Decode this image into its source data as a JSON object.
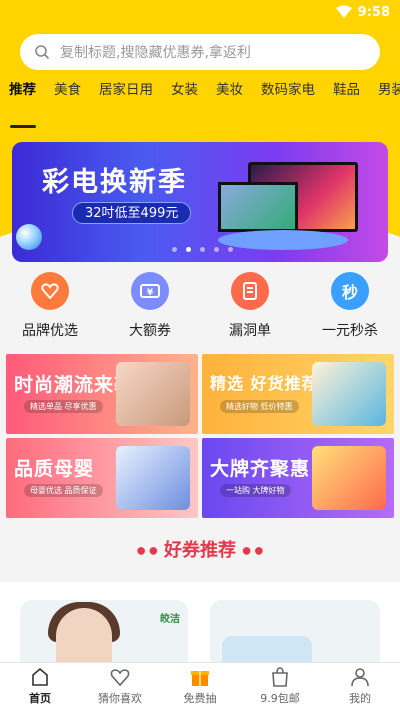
{
  "status_bar": {
    "time": "9:58"
  },
  "search": {
    "placeholder": "复制标题,搜隐藏优惠券,拿返利"
  },
  "category_tabs": [
    "推荐",
    "美食",
    "居家日用",
    "女装",
    "美妆",
    "数码家电",
    "鞋品",
    "男装"
  ],
  "banner": {
    "headline": "彩电换新季",
    "subline": "32吋低至499元"
  },
  "quick_links": [
    {
      "label": "品牌优选",
      "icon": "heart-badge-icon",
      "color": "#ff7a3d"
    },
    {
      "label": "大额券",
      "icon": "coupon-icon",
      "color": "#7b8cff"
    },
    {
      "label": "漏洞单",
      "icon": "bookmark-icon",
      "color": "#ff6a4d"
    },
    {
      "label": "一元秒杀",
      "icon": "flash-sale-icon",
      "color": "#3aa0ff",
      "glyph": "秒"
    }
  ],
  "promos": [
    {
      "title": "时尚潮流来袭",
      "caption": "精选单品 尽享优惠"
    },
    {
      "title": "精选 好货推荐",
      "caption": "精选好物 低价特惠"
    },
    {
      "title": "品质母婴",
      "caption": "母婴优选 品质保证"
    },
    {
      "title": "大牌齐聚惠",
      "caption": "一站购 大牌好物"
    }
  ],
  "section": {
    "title": "好券推荐"
  },
  "cards": {
    "card1_brand": "皎洁"
  },
  "bottom_nav": [
    {
      "label": "首页",
      "icon": "home-icon",
      "active": true
    },
    {
      "label": "猜你喜欢",
      "icon": "heart-icon",
      "active": false
    },
    {
      "label": "免费抽",
      "icon": "gift-icon",
      "active": false
    },
    {
      "label": "9.9包邮",
      "icon": "shopping-bag-icon",
      "active": false
    },
    {
      "label": "我的",
      "icon": "user-icon",
      "active": false
    }
  ],
  "colors": {
    "brand_yellow": "#ffd400",
    "accent_red": "#e4384b"
  }
}
